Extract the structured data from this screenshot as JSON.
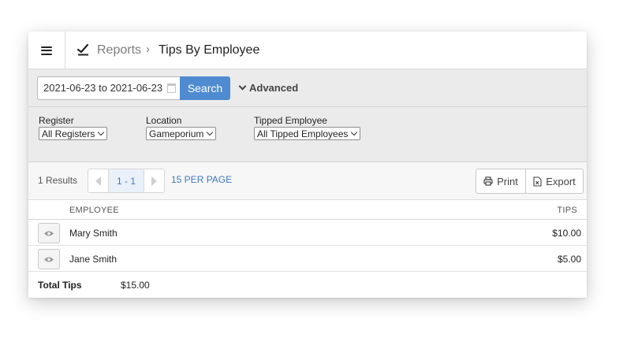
{
  "header": {
    "breadcrumb_reports": "Reports",
    "breadcrumb_separator": "›",
    "title": "Tips By Employee",
    "icons": {
      "menu": "hamburger-icon",
      "reports": "chart-line-icon"
    }
  },
  "search": {
    "date_range": "2021-06-23 to 2021-06-23",
    "button_label": "Search",
    "advanced_label": "Advanced",
    "icons": {
      "calendar": "calendar-icon",
      "advanced": "chevron-down-icon"
    }
  },
  "filters": {
    "register": {
      "label": "Register",
      "selected": "All Registers"
    },
    "location": {
      "label": "Location",
      "selected": "Gameporium"
    },
    "tipped_employee": {
      "label": "Tipped Employee",
      "selected": "All Tipped Employees"
    }
  },
  "results": {
    "count_text": "1 Results",
    "page_range": "1 - 1",
    "per_page": "15 PER PAGE",
    "print_label": "Print",
    "export_label": "Export",
    "icons": {
      "prev": "chevron-left-icon",
      "next": "chevron-right-icon",
      "print": "printer-icon",
      "export": "excel-file-icon"
    }
  },
  "table": {
    "columns": [
      "EMPLOYEE",
      "TIPS"
    ],
    "rows": [
      {
        "employee": "Mary Smith",
        "tips": "$10.00"
      },
      {
        "employee": "Jane Smith",
        "tips": "$5.00"
      }
    ],
    "row_icon": "eye-icon"
  },
  "totals": {
    "label": "Total Tips",
    "value": "$15.00"
  },
  "colors": {
    "accent": "#4f8bd1",
    "link": "#3f78c1",
    "filter_bg": "#ebebeb"
  }
}
